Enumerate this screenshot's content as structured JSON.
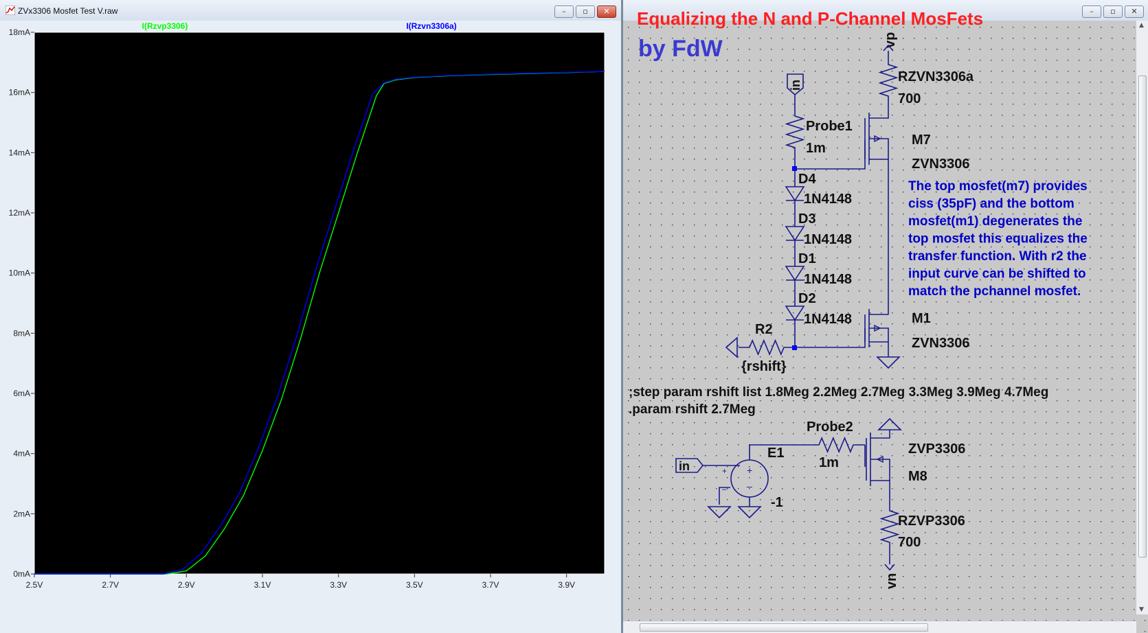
{
  "plot_window": {
    "title": "ZVx3306 Mosfet Test V.raw",
    "buttons": {
      "minimize": "–",
      "maximize": "▫",
      "close": "✕"
    }
  },
  "schematic_window": {
    "buttons": {
      "minimize": "–",
      "maximize": "▫",
      "close": "✕"
    }
  },
  "chart_data": {
    "type": "line",
    "xlabel": "",
    "ylabel": "",
    "xlim": [
      2.5,
      4.0
    ],
    "ylim": [
      0,
      18
    ],
    "x_ticks": [
      "2.5V",
      "2.7V",
      "2.9V",
      "3.1V",
      "3.3V",
      "3.5V",
      "3.7V",
      "3.9V"
    ],
    "y_ticks": [
      "0mA",
      "2mA",
      "4mA",
      "6mA",
      "8mA",
      "10mA",
      "12mA",
      "14mA",
      "16mA",
      "18mA"
    ],
    "grid": false,
    "background": "#000000",
    "series": [
      {
        "name": "I(Rzvp3306)",
        "color": "#00ff00",
        "x": [
          2.5,
          2.85,
          2.9,
          2.95,
          3.0,
          3.05,
          3.1,
          3.15,
          3.2,
          3.25,
          3.3,
          3.35,
          3.4,
          3.42,
          3.45,
          3.5,
          3.6,
          3.7,
          3.8,
          3.9,
          4.0
        ],
        "y": [
          0,
          0,
          0.1,
          0.6,
          1.5,
          2.6,
          4.1,
          5.8,
          7.8,
          10.0,
          12.0,
          14.0,
          15.9,
          16.3,
          16.42,
          16.5,
          16.56,
          16.6,
          16.63,
          16.66,
          16.7
        ]
      },
      {
        "name": "I(Rzvn3306a)",
        "color": "#0000ff",
        "x": [
          2.5,
          2.84,
          2.89,
          2.94,
          2.99,
          3.04,
          3.09,
          3.14,
          3.19,
          3.24,
          3.29,
          3.34,
          3.39,
          3.42,
          3.45,
          3.5,
          3.6,
          3.7,
          3.8,
          3.9,
          4.0
        ],
        "y": [
          0,
          0,
          0.15,
          0.7,
          1.6,
          2.7,
          4.2,
          5.9,
          7.9,
          10.1,
          12.1,
          14.1,
          15.95,
          16.32,
          16.44,
          16.51,
          16.57,
          16.61,
          16.64,
          16.67,
          16.7
        ]
      }
    ]
  },
  "schematic": {
    "title": "Equalizing the N and P-Channel MosFets",
    "author": "by FdW",
    "title_color": "#ff1f1f",
    "author_color": "#3a3ad0",
    "note_color": "#0000c8",
    "labels": {
      "vp": "vp",
      "rzvn_name": "RZVN3306a",
      "rzvn_value": "700",
      "in_top": "in",
      "probe1_name": "Probe1",
      "probe1_value": "1m",
      "m7_name": "M7",
      "m7_model": "ZVN3306",
      "d4_name": "D4",
      "d4_model": "1N4148",
      "d3_name": "D3",
      "d3_model": "1N4148",
      "d1_name": "D1",
      "d1_model": "1N4148",
      "d2_name": "D2",
      "d2_model": "1N4148",
      "m1_name": "M1",
      "m1_model": "ZVN3306",
      "r2_name": "R2",
      "r2_value": "{rshift}",
      "step_directive": ";step param rshift list 1.8Meg 2.2Meg 2.7Meg 3.3Meg 3.9Meg 4.7Meg",
      "param_directive": ".param rshift 2.7Meg",
      "in_bottom": "in",
      "e1_name": "E1",
      "e1_value": "-1",
      "probe2_name": "Probe2",
      "probe2_value": "1m",
      "zvp_model": "ZVP3306",
      "m8_name": "M8",
      "rzvp_name": "RZVP3306",
      "rzvp_value": "700",
      "vn": "vn"
    },
    "note_lines": [
      "The top mosfet(m7) provides",
      "ciss (35pF) and the bottom",
      "mosfet(m1) degenerates the",
      "top mosfet this equalizes the",
      "transfer function. With r2 the",
      "input curve can be shifted to",
      "match the pchannel mosfet."
    ]
  }
}
